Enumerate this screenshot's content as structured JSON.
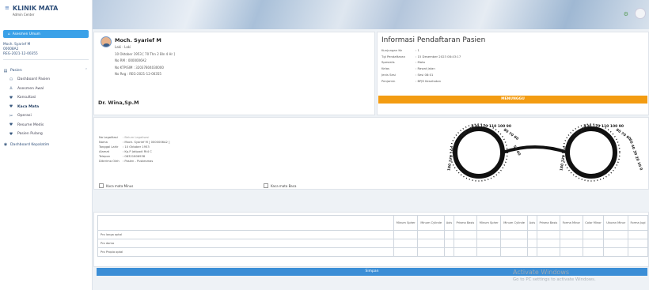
{
  "app": {
    "title": "KLINIK MATA",
    "subtitle": "Admin Center"
  },
  "sidebar": {
    "active_item": "Asesmen Umum",
    "user": {
      "name": "Moch. Syarief M",
      "id": "00008A2",
      "code": "REG-2021-12-00355"
    },
    "menu_head": "Pasien",
    "items": [
      {
        "label": "Dashboard Pasien",
        "icon": "dashboard-icon"
      },
      {
        "label": "Asesmen Awal",
        "icon": "user-icon"
      },
      {
        "label": "Konsultasi",
        "icon": "stethoscope-icon"
      },
      {
        "label": "Kaca Mata",
        "icon": "glasses-icon"
      },
      {
        "label": "Operasi",
        "icon": "scissors-icon"
      },
      {
        "label": "Resume Medis",
        "icon": "document-icon"
      },
      {
        "label": "Pasien Pulang",
        "icon": "exit-icon"
      }
    ],
    "bottom_item": "Dashboard Kepalatim"
  },
  "patient": {
    "name": "Moch. Syarief M",
    "gender": "Laki - Laki",
    "dob": "10 Oktober 1953 [ 70 Thn 2 Bln 4 Hr ]",
    "rm": "No RM : 0000006A2",
    "ktp": "No KTP/SIM : 32037804030000",
    "reg": "No Reg : REG-2021-12-00355",
    "doctor": "Dr. Wina,Sp.M"
  },
  "registration": {
    "title": "Informasi Pendaftaran Pasien",
    "rows": [
      {
        "k": "Kunjungan Ke",
        "v": ": 1"
      },
      {
        "k": "Tgl Pendaftaran",
        "v": ": 15 Desember 2023 08:43:17"
      },
      {
        "k": "Spesialis",
        "v": ": Mata"
      },
      {
        "k": "Kelas",
        "v": ": Rawat Jalan"
      },
      {
        "k": "Jenis Sesi",
        "v": ": Sesi 08:01"
      },
      {
        "k": "Penjamin",
        "v": ": BPJS Kesehatan"
      }
    ],
    "status": "MENUNGGU"
  },
  "glasses": {
    "rows": [
      {
        "k": "No Legalitasi",
        "v": ": Belum Legalisasi",
        "muted": true
      },
      {
        "k": "Nama",
        "v": ": Moch. Syarief M [ 0000006A2 ]"
      },
      {
        "k": "Tanggal Lahir",
        "v": ": 10 Oktober 1953"
      },
      {
        "k": "Alamat",
        "v": ": Kp.P Jatipadi Rt4 C"
      },
      {
        "k": "Telepon",
        "v": ": 08321806938"
      },
      {
        "k": "Diterima Oleh",
        "v": ": Pasien - Puskesmas"
      }
    ],
    "check_left": "Kaca mata Minus",
    "check_right": "Kaca mata Baca"
  },
  "rx": {
    "headers": [
      "Minum Spher",
      "Minum Cylinde",
      "Axis",
      "Prisma Basis",
      "Minum Spher",
      "Minum Cylinde",
      "Axis",
      "Prisma Basis",
      "Forma Minor",
      "Color Minor",
      "Ukuran Minor",
      "Forma Jugi"
    ],
    "rows": [
      "Pro longa optal",
      "Pro doma",
      "Pro Propia optal"
    ]
  },
  "save_label": "Simpan",
  "watermark": {
    "line1": "Activate Windows",
    "line2": "Go to PC settings to activate Windows."
  }
}
